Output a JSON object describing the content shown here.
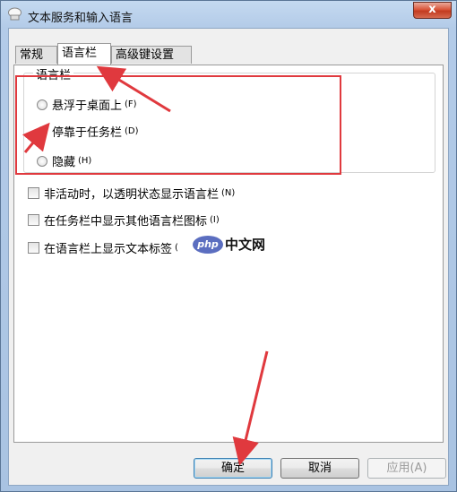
{
  "window": {
    "title": "文本服务和输入语言",
    "close_label": "x"
  },
  "tabs": [
    {
      "label": "常规",
      "active": false
    },
    {
      "label": "语言栏",
      "active": true
    },
    {
      "label": "高级键设置",
      "active": false
    }
  ],
  "language_bar": {
    "group_label": "语言栏",
    "options": [
      {
        "label": "悬浮于桌面上",
        "shortcut": "(F)",
        "selected": false
      },
      {
        "label": "停靠于任务栏",
        "shortcut": "(D)",
        "selected": true
      },
      {
        "label": "隐藏",
        "shortcut": "(H)",
        "selected": false
      }
    ]
  },
  "checkboxes": [
    {
      "label": "非活动时，以透明状态显示语言栏",
      "shortcut": "(N)",
      "checked": false
    },
    {
      "label": "在任务栏中显示其他语言栏图标",
      "shortcut": "(I)",
      "checked": false
    },
    {
      "label": "在语言栏上显示文本标签",
      "shortcut": "(",
      "checked": false
    }
  ],
  "watermark": {
    "logo": "php",
    "text": "中文网"
  },
  "buttons": {
    "ok": "确定",
    "cancel": "取消",
    "apply": "应用(A)"
  },
  "colors": {
    "annotation_red": "#e0393e"
  }
}
